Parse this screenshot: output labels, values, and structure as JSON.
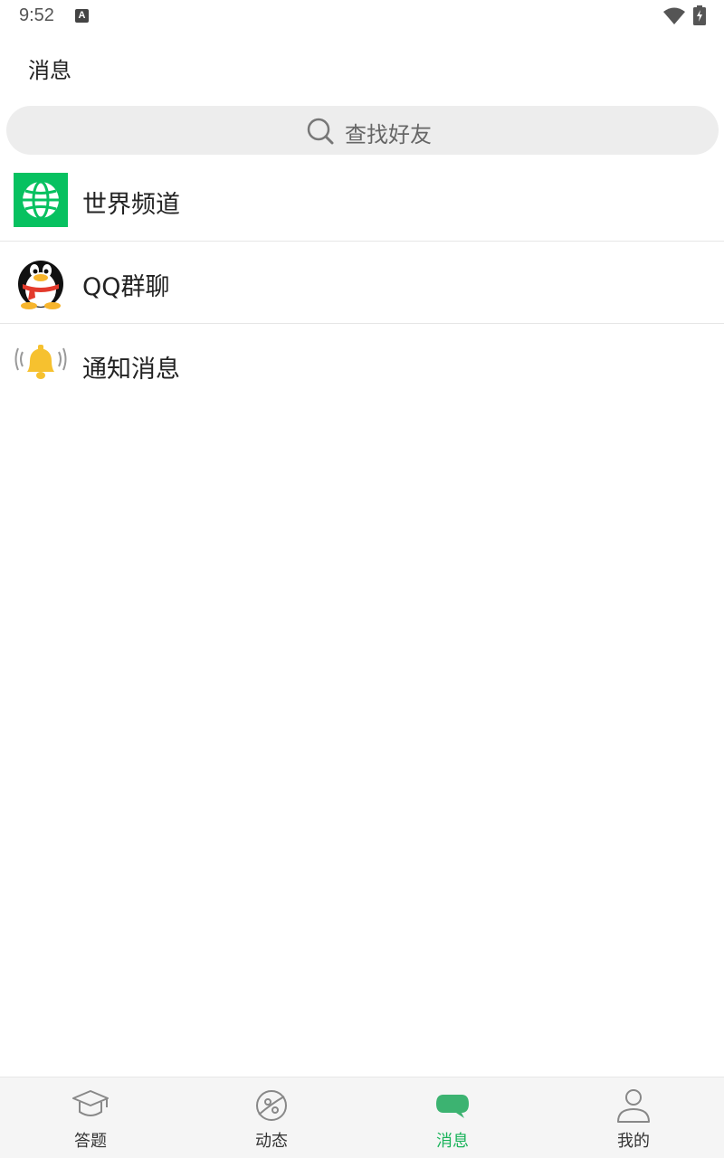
{
  "status_bar": {
    "time": "9:52",
    "notification_glyph": "A"
  },
  "header": {
    "title": "消息"
  },
  "search": {
    "placeholder": "查找好友"
  },
  "list": [
    {
      "label": "世界频道",
      "icon": "globe-icon",
      "color": "#07c160"
    },
    {
      "label": "QQ群聊",
      "icon": "qq-penguin-icon"
    },
    {
      "label": "通知消息",
      "icon": "bell-icon",
      "color": "#f6c12f"
    }
  ],
  "nav": [
    {
      "label": "答题",
      "icon": "graduation-cap-icon",
      "active": false
    },
    {
      "label": "动态",
      "icon": "planet-icon",
      "active": false
    },
    {
      "label": "消息",
      "icon": "chat-bubble-icon",
      "active": true
    },
    {
      "label": "我的",
      "icon": "user-icon",
      "active": false
    }
  ],
  "colors": {
    "accent": "#19b35a",
    "nav_background": "#f5f5f5",
    "search_background": "#ededed"
  }
}
